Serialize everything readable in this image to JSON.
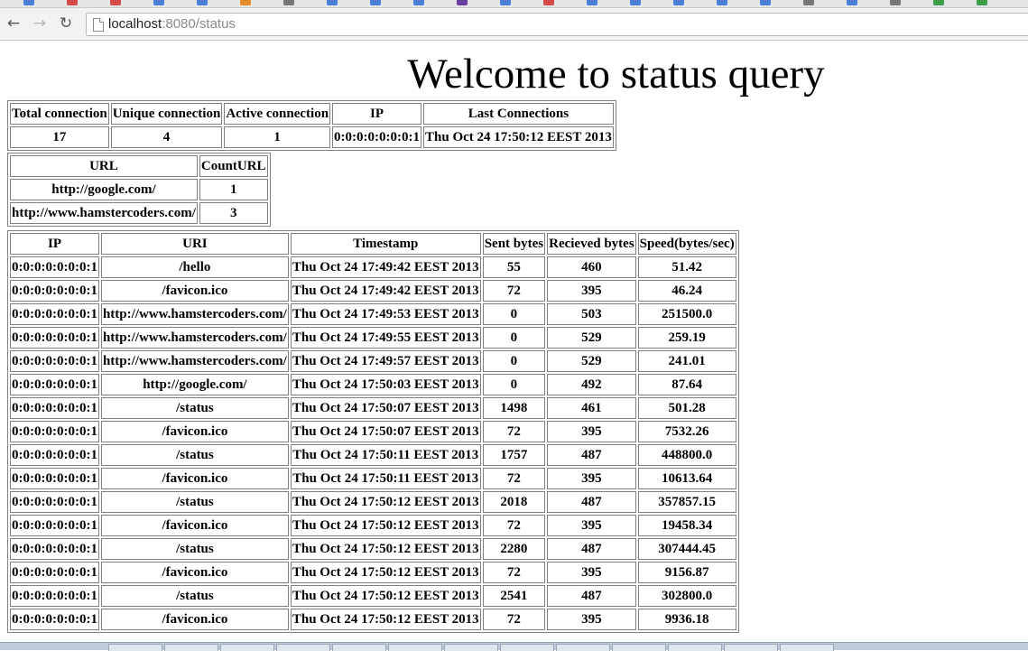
{
  "browser": {
    "url_host": "localhost",
    "url_rest": ":8080/status",
    "back_icon": "back-arrow-icon",
    "forward_icon": "forward-arrow-icon",
    "reload_icon": "reload-icon",
    "bookmark_colors": [
      "#4a7fd6",
      "#d64a4a",
      "#d64a4a",
      "#4a7fd6",
      "#4a7fd6",
      "#e08a2a",
      "#777777",
      "#4a7fd6",
      "#4a7fd6",
      "#4a7fd6",
      "#6a3fa0",
      "#4a7fd6",
      "#d64a4a",
      "#4a7fd6",
      "#4a7fd6",
      "#4a7fd6",
      "#4a7fd6",
      "#4a7fd6",
      "#777777",
      "#4a7fd6",
      "#777777",
      "#3aa04a",
      "#3aa04a"
    ]
  },
  "page": {
    "title": "Welcome to status query"
  },
  "stats": {
    "headers": [
      "Total connection",
      "Unique connection",
      "Active connection",
      "IP",
      "Last Connections"
    ],
    "values": [
      "17",
      "4",
      "1",
      "0:0:0:0:0:0:0:1",
      "Thu Oct 24 17:50:12 EEST 2013"
    ]
  },
  "urls": {
    "headers": [
      "URL",
      "CountURL"
    ],
    "rows": [
      [
        "http://google.com/",
        "1"
      ],
      [
        "http://www.hamstercoders.com/",
        "3"
      ]
    ]
  },
  "requests": {
    "headers": [
      "IP",
      "URI",
      "Timestamp",
      "Sent bytes",
      "Recieved bytes",
      "Speed(bytes/sec)"
    ],
    "rows": [
      [
        "0:0:0:0:0:0:0:1",
        "/hello",
        "Thu Oct 24 17:49:42 EEST 2013",
        "55",
        "460",
        "51.42"
      ],
      [
        "0:0:0:0:0:0:0:1",
        "/favicon.ico",
        "Thu Oct 24 17:49:42 EEST 2013",
        "72",
        "395",
        "46.24"
      ],
      [
        "0:0:0:0:0:0:0:1",
        "http://www.hamstercoders.com/",
        "Thu Oct 24 17:49:53 EEST 2013",
        "0",
        "503",
        "251500.0"
      ],
      [
        "0:0:0:0:0:0:0:1",
        "http://www.hamstercoders.com/",
        "Thu Oct 24 17:49:55 EEST 2013",
        "0",
        "529",
        "259.19"
      ],
      [
        "0:0:0:0:0:0:0:1",
        "http://www.hamstercoders.com/",
        "Thu Oct 24 17:49:57 EEST 2013",
        "0",
        "529",
        "241.01"
      ],
      [
        "0:0:0:0:0:0:0:1",
        "http://google.com/",
        "Thu Oct 24 17:50:03 EEST 2013",
        "0",
        "492",
        "87.64"
      ],
      [
        "0:0:0:0:0:0:0:1",
        "/status",
        "Thu Oct 24 17:50:07 EEST 2013",
        "1498",
        "461",
        "501.28"
      ],
      [
        "0:0:0:0:0:0:0:1",
        "/favicon.ico",
        "Thu Oct 24 17:50:07 EEST 2013",
        "72",
        "395",
        "7532.26"
      ],
      [
        "0:0:0:0:0:0:0:1",
        "/status",
        "Thu Oct 24 17:50:11 EEST 2013",
        "1757",
        "487",
        "448800.0"
      ],
      [
        "0:0:0:0:0:0:0:1",
        "/favicon.ico",
        "Thu Oct 24 17:50:11 EEST 2013",
        "72",
        "395",
        "10613.64"
      ],
      [
        "0:0:0:0:0:0:0:1",
        "/status",
        "Thu Oct 24 17:50:12 EEST 2013",
        "2018",
        "487",
        "357857.15"
      ],
      [
        "0:0:0:0:0:0:0:1",
        "/favicon.ico",
        "Thu Oct 24 17:50:12 EEST 2013",
        "72",
        "395",
        "19458.34"
      ],
      [
        "0:0:0:0:0:0:0:1",
        "/status",
        "Thu Oct 24 17:50:12 EEST 2013",
        "2280",
        "487",
        "307444.45"
      ],
      [
        "0:0:0:0:0:0:0:1",
        "/favicon.ico",
        "Thu Oct 24 17:50:12 EEST 2013",
        "72",
        "395",
        "9156.87"
      ],
      [
        "0:0:0:0:0:0:0:1",
        "/status",
        "Thu Oct 24 17:50:12 EEST 2013",
        "2541",
        "487",
        "302800.0"
      ],
      [
        "0:0:0:0:0:0:0:1",
        "/favicon.ico",
        "Thu Oct 24 17:50:12 EEST 2013",
        "72",
        "395",
        "9936.18"
      ]
    ]
  }
}
